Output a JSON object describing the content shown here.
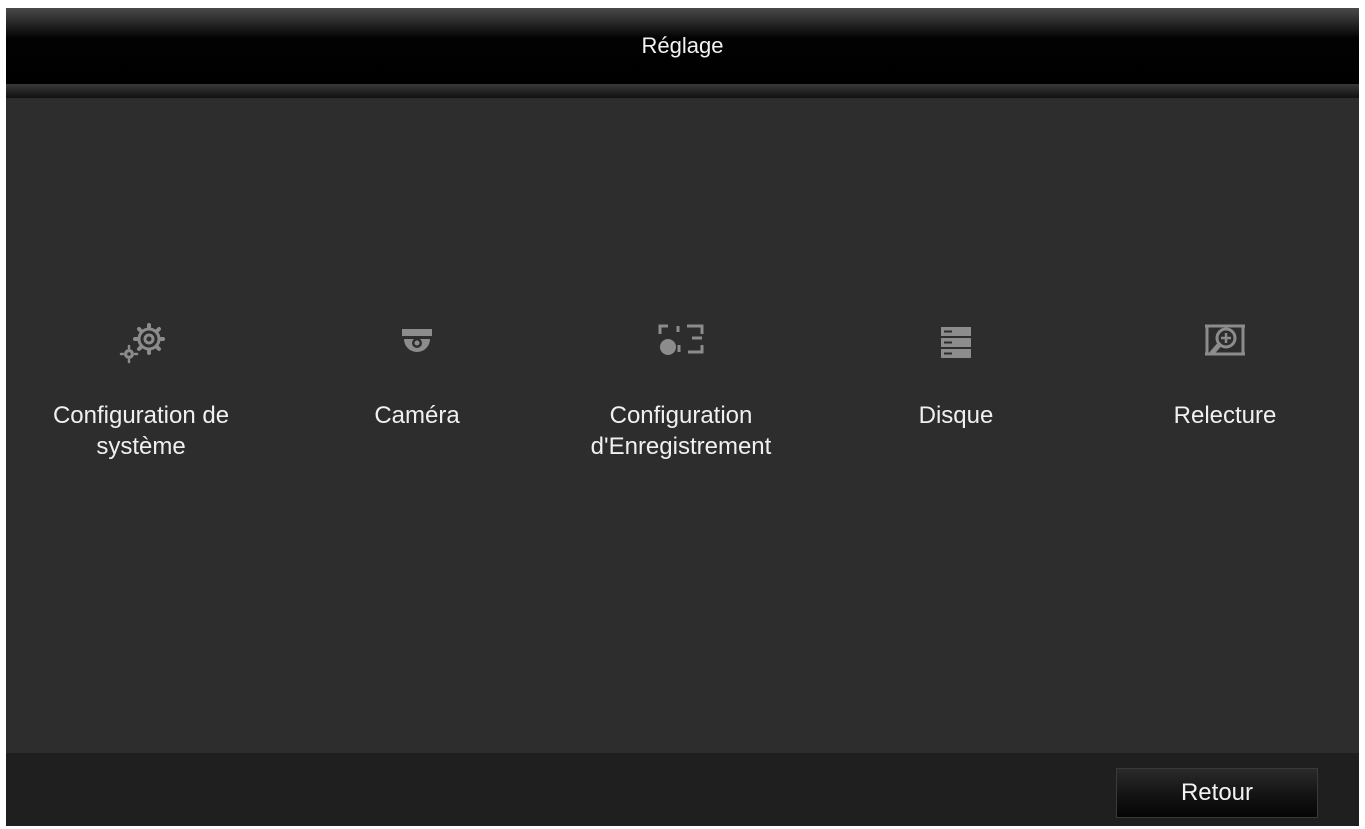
{
  "window": {
    "title": "Réglage"
  },
  "menu": {
    "items": [
      {
        "label": "Configuration de\nsystème",
        "icon": "gear-icon"
      },
      {
        "label": "Caméra",
        "icon": "dome-camera-icon"
      },
      {
        "label": "Configuration\nd'Enregistrement",
        "icon": "record-config-icon"
      },
      {
        "label": "Disque",
        "icon": "hdd-icon"
      },
      {
        "label": "Relecture",
        "icon": "playback-search-icon"
      }
    ]
  },
  "footer": {
    "back_label": "Retour"
  },
  "colors": {
    "background": "#2d2d2d",
    "title_bar": "#000000",
    "icon": "#8c8c8c",
    "text": "#f0f0f0"
  }
}
